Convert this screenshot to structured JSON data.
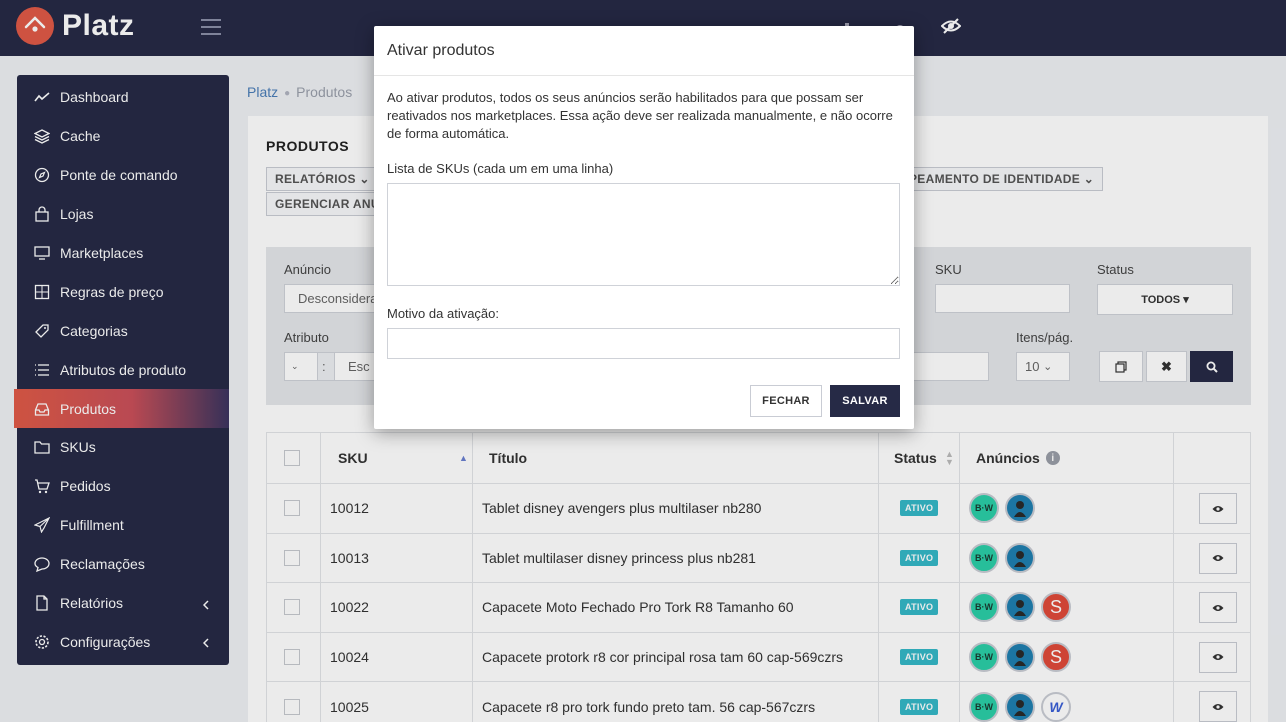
{
  "app": {
    "name": "Platz"
  },
  "sidebar": {
    "items": [
      {
        "label": "Dashboard",
        "icon": "trend-icon"
      },
      {
        "label": "Cache",
        "icon": "layers-icon"
      },
      {
        "label": "Ponte de comando",
        "icon": "compass-icon"
      },
      {
        "label": "Lojas",
        "icon": "bag-icon"
      },
      {
        "label": "Marketplaces",
        "icon": "monitor-icon"
      },
      {
        "label": "Regras de preço",
        "icon": "calculator-icon"
      },
      {
        "label": "Categorias",
        "icon": "tag-icon"
      },
      {
        "label": "Atributos de produto",
        "icon": "list-icon"
      },
      {
        "label": "Produtos",
        "icon": "inbox-icon",
        "active": true
      },
      {
        "label": "SKUs",
        "icon": "folder-icon"
      },
      {
        "label": "Pedidos",
        "icon": "cart-icon"
      },
      {
        "label": "Fulfillment",
        "icon": "plane-icon"
      },
      {
        "label": "Reclamações",
        "icon": "chat-icon"
      },
      {
        "label": "Relatórios",
        "icon": "file-icon",
        "has_chevron": true
      },
      {
        "label": "Configurações",
        "icon": "gear-icon",
        "has_chevron": true
      }
    ]
  },
  "breadcrumb": {
    "root": "Platz",
    "current": "Produtos"
  },
  "page": {
    "title": "PRODUTOS",
    "btn_relatorios": "RELATÓRIOS",
    "btn_mapeamento": "PEAMENTO DE IDENTIDADE",
    "btn_gerenciar": "GERENCIAR ANÚ"
  },
  "filters": {
    "anuncio_label": "Anúncio",
    "anuncio_value": "Desconsiderar",
    "sku_label": "SKU",
    "status_label": "Status",
    "status_value": "TODOS",
    "atributo_label": "Atributo",
    "atributo_value": "Esc",
    "itens_label": "Itens/pág.",
    "itens_value": "10"
  },
  "table": {
    "headers": {
      "sku": "SKU",
      "titulo": "Título",
      "status": "Status",
      "anuncios": "Anúncios"
    },
    "rows": [
      {
        "sku": "10012",
        "titulo": "Tablet disney avengers plus multilaser nb280",
        "status": "ATIVO",
        "channels": [
          "bw",
          "avatar"
        ]
      },
      {
        "sku": "10013",
        "titulo": "Tablet multilaser disney princess plus nb281",
        "status": "ATIVO",
        "channels": [
          "bw",
          "avatar"
        ]
      },
      {
        "sku": "10022",
        "titulo": "Capacete Moto Fechado Pro Tork R8 Tamanho 60",
        "status": "ATIVO",
        "channels": [
          "bw",
          "avatar",
          "s"
        ]
      },
      {
        "sku": "10024",
        "titulo": "Capacete protork r8 cor principal rosa tam 60 cap-569czrs",
        "status": "ATIVO",
        "channels": [
          "bw",
          "avatar",
          "s"
        ]
      },
      {
        "sku": "10025",
        "titulo": "Capacete r8 pro tork fundo preto tam. 56 cap-567czrs",
        "status": "ATIVO",
        "channels": [
          "bw",
          "avatar",
          "w"
        ]
      }
    ]
  },
  "modal": {
    "title": "Ativar produtos",
    "description": "Ao ativar produtos, todos os seus anúncios serão habilitados para que possam ser reativados nos marketplaces. Essa ação deve ser realizada manualmente, e não ocorre de forma automática.",
    "skus_label": "Lista de SKUs (cada um em uma linha)",
    "skus_value": "",
    "motivo_label": "Motivo da ativação:",
    "motivo_value": "",
    "close_label": "FECHAR",
    "save_label": "SALVAR"
  },
  "colors": {
    "navy": "#262a46",
    "accent": "#e05a47",
    "badge": "#35b8c7"
  }
}
